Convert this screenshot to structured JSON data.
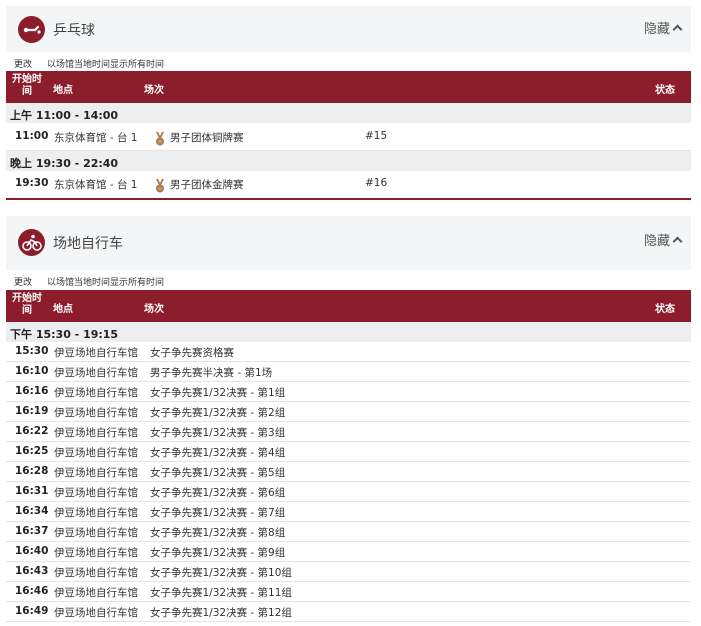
{
  "colors": {
    "accent": "#8b1d2d",
    "header_bg": "#f4f5f6",
    "period_bg": "#eceeef",
    "medal": "#a9794f"
  },
  "sections": [
    {
      "sport": "乒乓球",
      "icon": "table-tennis-icon",
      "hide_label": "隐藏",
      "change_label": "更改",
      "time_note": "以场馆当地时间显示所有时间",
      "columns": {
        "time": "开始时间",
        "venue": "地点",
        "event": "场次",
        "status": "状态"
      },
      "periods": [
        {
          "label": "上午  11:00 - 14:00",
          "rows": [
            {
              "time": "11:00",
              "venue": "东京体育馆 - 台 1",
              "medal": "bronze-medal-icon",
              "event": "男子团体铜牌赛",
              "num": "#15"
            }
          ]
        },
        {
          "label": "晚上  19:30 - 22:40",
          "rows": [
            {
              "time": "19:30",
              "venue": "东京体育馆 - 台 1",
              "medal": "gold-medal-icon",
              "event": "男子团体金牌赛",
              "num": "#16"
            }
          ]
        }
      ]
    },
    {
      "sport": "场地自行车",
      "icon": "track-cycling-icon",
      "hide_label": "隐藏",
      "change_label": "更改",
      "time_note": "以场馆当地时间显示所有时间",
      "columns": {
        "time": "开始时间",
        "venue": "地点",
        "event": "场次",
        "status": "状态"
      },
      "periods": [
        {
          "label": "下午  15:30 - 19:15",
          "rows": [
            {
              "time": "15:30",
              "venue": "伊豆场地自行车馆",
              "event": "女子争先赛资格赛"
            },
            {
              "time": "16:10",
              "venue": "伊豆场地自行车馆",
              "event": "男子争先赛半决赛 - 第1场"
            },
            {
              "time": "16:16",
              "venue": "伊豆场地自行车馆",
              "event": "女子争先赛1/32决赛 - 第1组"
            },
            {
              "time": "16:19",
              "venue": "伊豆场地自行车馆",
              "event": "女子争先赛1/32决赛 - 第2组"
            },
            {
              "time": "16:22",
              "venue": "伊豆场地自行车馆",
              "event": "女子争先赛1/32决赛 - 第3组"
            },
            {
              "time": "16:25",
              "venue": "伊豆场地自行车馆",
              "event": "女子争先赛1/32决赛 - 第4组"
            },
            {
              "time": "16:28",
              "venue": "伊豆场地自行车馆",
              "event": "女子争先赛1/32决赛 - 第5组"
            },
            {
              "time": "16:31",
              "venue": "伊豆场地自行车馆",
              "event": "女子争先赛1/32决赛 - 第6组"
            },
            {
              "time": "16:34",
              "venue": "伊豆场地自行车馆",
              "event": "女子争先赛1/32决赛 - 第7组"
            },
            {
              "time": "16:37",
              "venue": "伊豆场地自行车馆",
              "event": "女子争先赛1/32决赛 - 第8组"
            },
            {
              "time": "16:40",
              "venue": "伊豆场地自行车馆",
              "event": "女子争先赛1/32决赛 - 第9组"
            },
            {
              "time": "16:43",
              "venue": "伊豆场地自行车馆",
              "event": "女子争先赛1/32决赛 - 第10组"
            },
            {
              "time": "16:46",
              "venue": "伊豆场地自行车馆",
              "event": "女子争先赛1/32决赛 - 第11组"
            },
            {
              "time": "16:49",
              "venue": "伊豆场地自行车馆",
              "event": "女子争先赛1/32决赛 - 第12组"
            }
          ]
        }
      ]
    }
  ]
}
